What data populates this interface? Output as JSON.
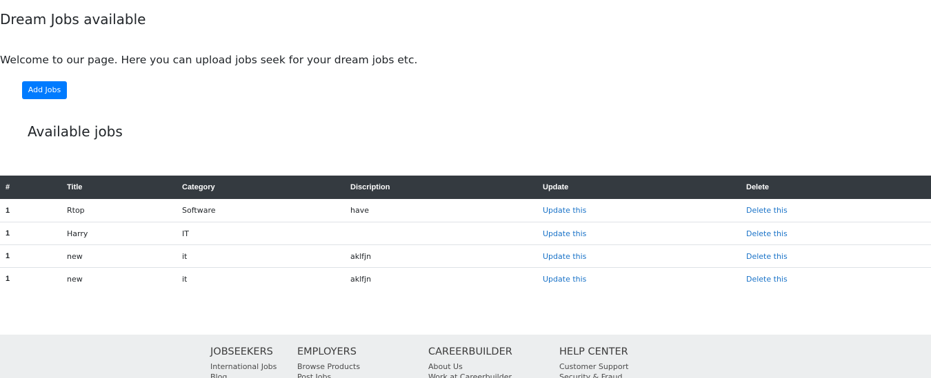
{
  "header": {
    "title": "Dream Jobs available",
    "welcome": "Welcome to our page. Here you can upload jobs seek for your dream jobs etc."
  },
  "actions": {
    "add_jobs_label": "Add Jobs"
  },
  "jobs": {
    "section_title": "Available jobs",
    "columns": [
      "#",
      "Title",
      "Category",
      "Discription",
      "Update",
      "Delete"
    ],
    "rows": [
      {
        "num": "1",
        "title": "Rtop",
        "category": "Software",
        "description": "have",
        "update": "Update this",
        "delete": "Delete this"
      },
      {
        "num": "1",
        "title": "Harry",
        "category": "IT",
        "description": "",
        "update": "Update this",
        "delete": "Delete this"
      },
      {
        "num": "1",
        "title": "new",
        "category": "it",
        "description": "aklfjn",
        "update": "Update this",
        "delete": "Delete this"
      },
      {
        "num": "1",
        "title": "new",
        "category": "it",
        "description": "aklfjn",
        "update": "Update this",
        "delete": "Delete this"
      }
    ]
  },
  "footer": {
    "columns": [
      {
        "heading": "JOBSEEKERS",
        "links": [
          "International Jobs",
          "Blog"
        ]
      },
      {
        "heading": "EMPLOYERS",
        "links": [
          "Browse Products",
          "Post Jobs"
        ]
      },
      {
        "heading": "CAREERBUILDER",
        "links": [
          "About Us",
          "Work at Careerbuilder"
        ]
      },
      {
        "heading": "HELP CENTER",
        "links": [
          "Customer Support",
          "Security & Fraud"
        ]
      }
    ]
  },
  "colors": {
    "primary": "#007bff",
    "table_header": "#343a40",
    "link": "#1a73c8",
    "footer_bg": "#eceeef"
  }
}
